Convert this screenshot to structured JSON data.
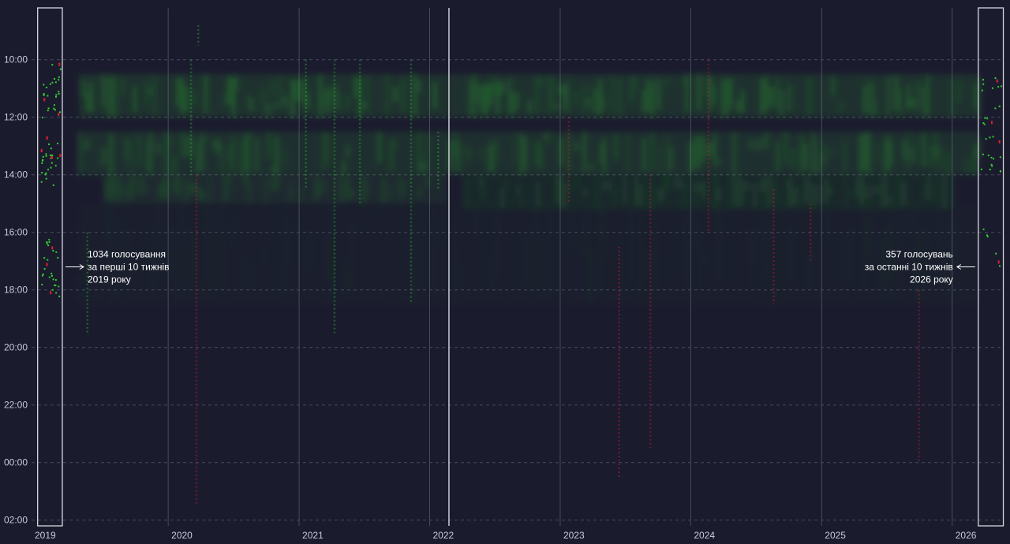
{
  "chart_data": {
    "type": "scatter",
    "title": "",
    "xlabel": "",
    "ylabel": "",
    "grid": true,
    "colors": {
      "background": "#1b1b2e",
      "for": "#2fd12f",
      "against": "#e0202c",
      "gridline": "#4a4a60",
      "frame": "#d8d8e0"
    },
    "x_ticks": [
      "2019",
      "2020",
      "2021",
      "2022",
      "2023",
      "2024",
      "2025",
      "2026"
    ],
    "x_tick_dates": [
      "2019-01-01",
      "2020-01-01",
      "2021-01-01",
      "2022-01-01",
      "2023-01-01",
      "2024-01-01",
      "2025-01-01",
      "2026-01-01"
    ],
    "xlim": [
      "2018-12-15",
      "2026-05-25"
    ],
    "y_ticks": [
      "10:00",
      "12:00",
      "14:00",
      "16:00",
      "18:00",
      "20:00",
      "22:00",
      "00:00",
      "02:00"
    ],
    "y_tick_hours": [
      10,
      12,
      14,
      16,
      18,
      20,
      22,
      24,
      26
    ],
    "ylim_hours": [
      8.2,
      26.2
    ],
    "y_inverted": true,
    "reference_line_date": "2022-02-24",
    "series": [],
    "density_bands": [
      {
        "from": "2019-04-25",
        "to": "2026-03-15",
        "start": 10.5,
        "end": 12.0,
        "intensity": 0.55,
        "color": "for"
      },
      {
        "from": "2019-04-25",
        "to": "2026-03-15",
        "start": 12.5,
        "end": 14.0,
        "intensity": 0.5,
        "color": "for"
      },
      {
        "from": "2019-07-01",
        "to": "2022-02-20",
        "start": 14.0,
        "end": 15.0,
        "intensity": 0.35,
        "color": "for"
      },
      {
        "from": "2022-04-01",
        "to": "2025-12-31",
        "start": 14.0,
        "end": 15.2,
        "intensity": 0.3,
        "color": "for"
      },
      {
        "from": "2019-04-25",
        "to": "2026-03-15",
        "start": 15.0,
        "end": 18.5,
        "intensity": 0.08,
        "color": "for"
      }
    ],
    "streaks": [
      {
        "date": "2019-05-20",
        "start": 16.0,
        "end": 19.5,
        "color": "for"
      },
      {
        "date": "2020-03-05",
        "start": 10.0,
        "end": 14.0,
        "color": "for"
      },
      {
        "date": "2020-03-20",
        "start": 14.0,
        "end": 25.5,
        "color": "against"
      },
      {
        "date": "2020-03-25",
        "start": 8.8,
        "end": 9.5,
        "color": "for"
      },
      {
        "date": "2021-01-20",
        "start": 10.0,
        "end": 14.5,
        "color": "for"
      },
      {
        "date": "2021-04-10",
        "start": 10.0,
        "end": 19.5,
        "color": "for"
      },
      {
        "date": "2021-06-20",
        "start": 10.0,
        "end": 15.0,
        "color": "for"
      },
      {
        "date": "2021-11-10",
        "start": 10.0,
        "end": 18.5,
        "color": "for"
      },
      {
        "date": "2022-01-25",
        "start": 12.5,
        "end": 14.5,
        "color": "for"
      },
      {
        "date": "2023-01-25",
        "start": 12.0,
        "end": 15.0,
        "color": "against"
      },
      {
        "date": "2023-06-15",
        "start": 16.5,
        "end": 24.5,
        "color": "against"
      },
      {
        "date": "2023-09-10",
        "start": 14.0,
        "end": 23.5,
        "color": "against"
      },
      {
        "date": "2024-02-20",
        "start": 10.0,
        "end": 16.0,
        "color": "against"
      },
      {
        "date": "2024-08-20",
        "start": 14.5,
        "end": 18.5,
        "color": "against"
      },
      {
        "date": "2024-12-01",
        "start": 15.0,
        "end": 17.0,
        "color": "against"
      },
      {
        "date": "2025-09-30",
        "start": 18.0,
        "end": 24.0,
        "color": "against"
      }
    ],
    "highlight_periods": [
      {
        "label": "1034 голосування\nза перші 10 тижнів\n2019 року",
        "from": "2019-01-01",
        "to": "2019-03-11",
        "count": 1034,
        "weeks": 10,
        "label_side": "right"
      },
      {
        "label": "357 голосувань\nза останні 10 тижнів\n2026 року",
        "from": "2026-03-15",
        "to": "2026-05-24",
        "count": 357,
        "weeks": 10,
        "label_side": "left"
      }
    ]
  }
}
